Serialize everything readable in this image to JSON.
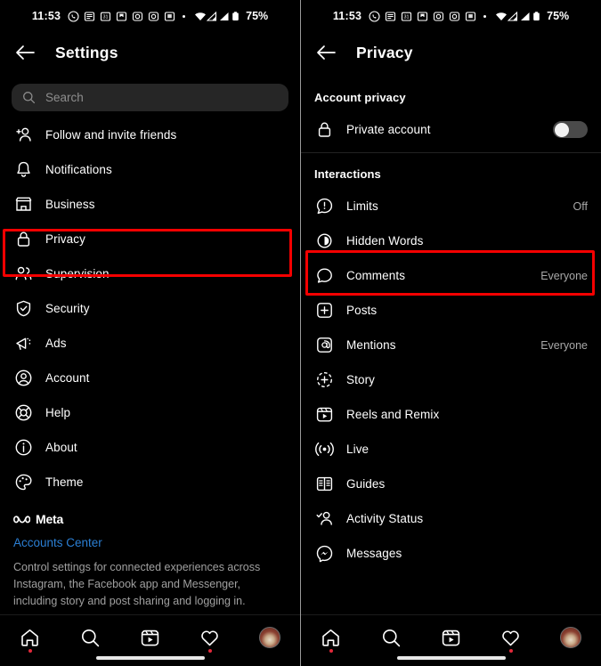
{
  "status_bar": {
    "time": "11:53",
    "battery": "75%",
    "notification_icons": [
      "whatsapp-icon",
      "news-icon",
      "calendar-31-icon",
      "save-icon",
      "instagram-icon",
      "camera-icon",
      "app-icon"
    ],
    "signal_icons": [
      "wifi-icon",
      "signal-1-icon",
      "signal-2-icon",
      "battery-icon"
    ]
  },
  "left_panel": {
    "header": {
      "title": "Settings",
      "back_icon": "back-arrow-icon"
    },
    "search": {
      "placeholder": "Search",
      "icon": "search-icon"
    },
    "items": [
      {
        "label": "Follow and invite friends",
        "icon": "add-person-icon",
        "highlighted": false
      },
      {
        "label": "Notifications",
        "icon": "bell-icon",
        "highlighted": false
      },
      {
        "label": "Business",
        "icon": "store-icon",
        "highlighted": false
      },
      {
        "label": "Privacy",
        "icon": "lock-icon",
        "highlighted": true
      },
      {
        "label": "Supervision",
        "icon": "people-icon",
        "highlighted": false
      },
      {
        "label": "Security",
        "icon": "shield-check-icon",
        "highlighted": false
      },
      {
        "label": "Ads",
        "icon": "megaphone-icon",
        "highlighted": false
      },
      {
        "label": "Account",
        "icon": "account-circle-icon",
        "highlighted": false
      },
      {
        "label": "Help",
        "icon": "lifebuoy-icon",
        "highlighted": false
      },
      {
        "label": "About",
        "icon": "info-circle-icon",
        "highlighted": false
      },
      {
        "label": "Theme",
        "icon": "palette-icon",
        "highlighted": false
      }
    ],
    "meta": {
      "brand": "Meta",
      "brand_icon": "meta-infinity-icon",
      "accounts_center_link": "Accounts Center",
      "description": "Control settings for connected experiences across Instagram, the Facebook app and Messenger, including story and post sharing and logging in."
    }
  },
  "right_panel": {
    "header": {
      "title": "Privacy",
      "back_icon": "back-arrow-icon"
    },
    "sections": [
      {
        "title": "Account privacy",
        "items": [
          {
            "label": "Private account",
            "icon": "lock-icon",
            "control": "toggle",
            "toggle_on": false,
            "value": "",
            "highlighted": false
          }
        ]
      },
      {
        "title": "Interactions",
        "items": [
          {
            "label": "Limits",
            "icon": "limits-icon",
            "value": "Off",
            "highlighted": false
          },
          {
            "label": "Hidden Words",
            "icon": "hidden-words-icon",
            "value": "",
            "highlighted": false
          },
          {
            "label": "Comments",
            "icon": "comment-icon",
            "value": "Everyone",
            "highlighted": false
          },
          {
            "label": "Posts",
            "icon": "plus-square-icon",
            "value": "",
            "highlighted": false
          },
          {
            "label": "Mentions",
            "icon": "at-square-icon",
            "value": "Everyone",
            "highlighted": false
          },
          {
            "label": "Story",
            "icon": "story-plus-icon",
            "value": "",
            "highlighted": false
          },
          {
            "label": "Reels and Remix",
            "icon": "reels-icon",
            "value": "",
            "highlighted": false
          },
          {
            "label": "Live",
            "icon": "live-icon",
            "value": "",
            "highlighted": false
          },
          {
            "label": "Guides",
            "icon": "guides-icon",
            "value": "",
            "highlighted": false
          },
          {
            "label": "Activity Status",
            "icon": "activity-status-icon",
            "value": "",
            "highlighted": false
          },
          {
            "label": "Messages",
            "icon": "messenger-icon",
            "value": "",
            "highlighted": true
          }
        ]
      }
    ]
  },
  "bottom_nav": {
    "items": [
      {
        "icon": "home-icon",
        "badge": true
      },
      {
        "icon": "search-icon",
        "badge": false
      },
      {
        "icon": "reels-icon",
        "badge": false
      },
      {
        "icon": "heart-icon",
        "badge": true
      },
      {
        "icon": "profile-avatar",
        "badge": false
      }
    ]
  },
  "colors": {
    "highlight": "#f40000",
    "link": "#2b7fd4",
    "background": "#000000",
    "search_bg": "#262626",
    "secondary_text": "#a8a8a8",
    "badge": "#e2293a"
  }
}
